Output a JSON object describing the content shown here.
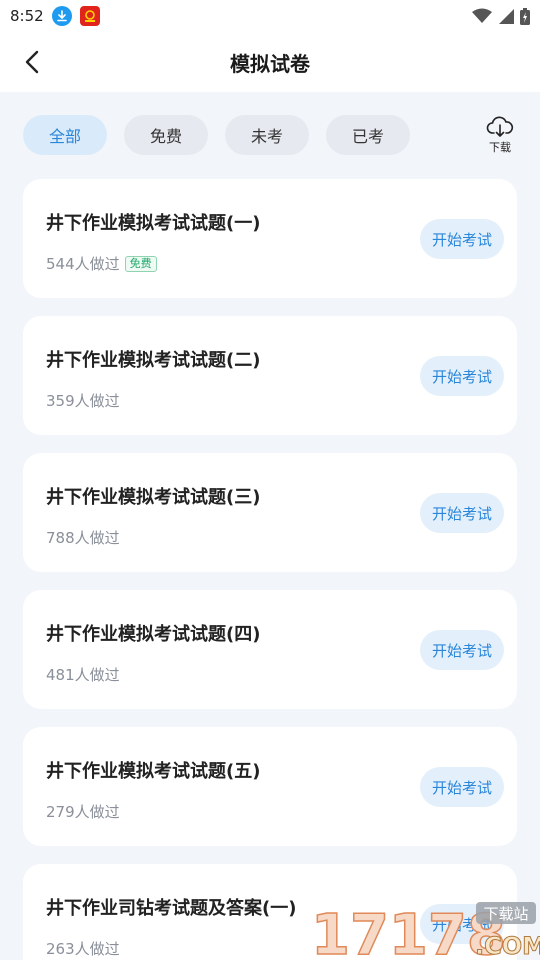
{
  "status_bar": {
    "time": "8:52"
  },
  "header": {
    "title": "模拟试卷"
  },
  "filters": {
    "tabs": [
      {
        "label": "全部",
        "active": true
      },
      {
        "label": "免费",
        "active": false
      },
      {
        "label": "未考",
        "active": false
      },
      {
        "label": "已考",
        "active": false
      }
    ],
    "download_label": "下载"
  },
  "exams": [
    {
      "title": "井下作业模拟考试试题(一)",
      "count": "544人做过",
      "badge": "免费",
      "action": "开始考试"
    },
    {
      "title": "井下作业模拟考试试题(二)",
      "count": "359人做过",
      "badge": "",
      "action": "开始考试"
    },
    {
      "title": "井下作业模拟考试试题(三)",
      "count": "788人做过",
      "badge": "",
      "action": "开始考试"
    },
    {
      "title": "井下作业模拟考试试题(四)",
      "count": "481人做过",
      "badge": "",
      "action": "开始考试"
    },
    {
      "title": "井下作业模拟考试试题(五)",
      "count": "279人做过",
      "badge": "",
      "action": "开始考试"
    },
    {
      "title": "井下作业司钻考试题及答案(一)",
      "count": "263人做过",
      "badge": "",
      "action": "开始考试"
    }
  ],
  "watermark": {
    "brand": "17178",
    "suffix": ".COM",
    "tag": "下载站"
  },
  "colors": {
    "accent": "#2a86d9",
    "free_green": "#22a86b",
    "background": "#f2f5f9"
  }
}
